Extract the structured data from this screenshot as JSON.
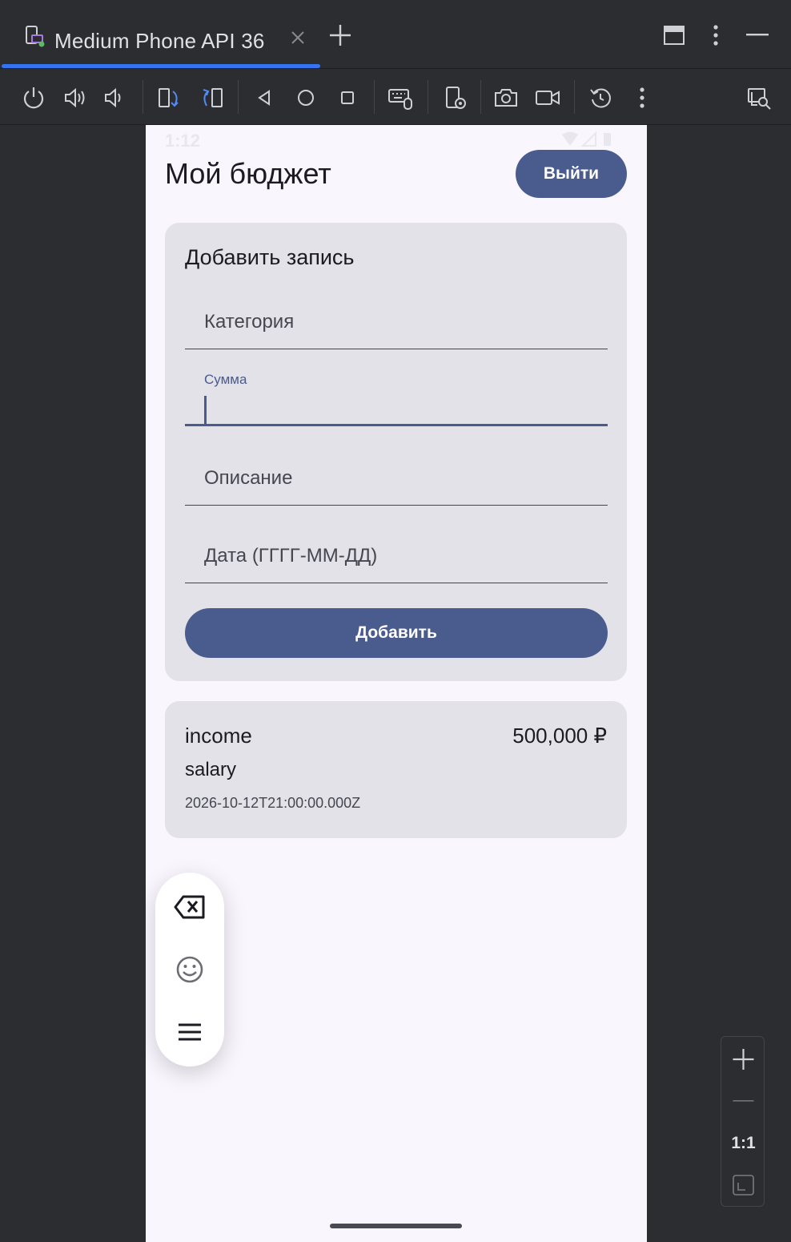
{
  "window": {
    "tab_title": "Medium Phone API 36",
    "tab_icon": "device-mirror-icon"
  },
  "toolbar": {
    "tools": [
      "power-icon",
      "volume-up-icon",
      "volume-down-icon",
      "rotate-left-icon",
      "rotate-right-icon",
      "back-icon",
      "home-icon",
      "overview-icon",
      "keyboard-mouse-icon",
      "device-settings-icon",
      "camera-icon",
      "video-icon",
      "reset-icon",
      "more-icon",
      "inspect-icon"
    ]
  },
  "status_bar": {
    "time": "1:12"
  },
  "app": {
    "title": "Мой бюджет",
    "logout_label": "Выйти",
    "form": {
      "title": "Добавить запись",
      "category_placeholder": "Категория",
      "amount_label": "Сумма",
      "description_placeholder": "Описание",
      "date_placeholder": "Дата (ГГГГ-ММ-ДД)",
      "submit_label": "Добавить"
    },
    "entries": [
      {
        "type": "income",
        "amount": "500,000 ₽",
        "description": "salary",
        "date": "2026-10-12T21:00:00.000Z"
      }
    ]
  },
  "keyboard_float": {
    "items": [
      "backspace-icon",
      "emoji-icon",
      "menu-icon"
    ]
  },
  "zoom": {
    "one_to_one": "1:1"
  },
  "colors": {
    "accent": "#4a5b8e",
    "tab_underline": "#3574f0",
    "ide_background": "#2b2d30",
    "screen_background": "#f9f7fd",
    "card_background": "#e3e2e8"
  }
}
